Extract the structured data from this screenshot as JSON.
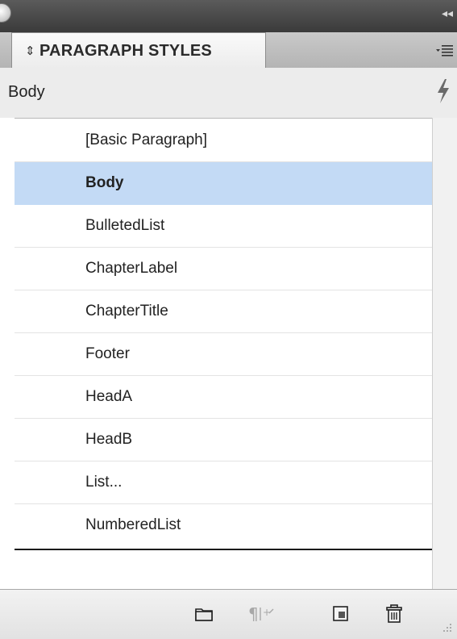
{
  "panel": {
    "tab_title": "PARAGRAPH STYLES",
    "current_style": "Body"
  },
  "styles": [
    {
      "label": "[Basic Paragraph]",
      "selected": false
    },
    {
      "label": "Body",
      "selected": true
    },
    {
      "label": "BulletedList",
      "selected": false
    },
    {
      "label": "ChapterLabel",
      "selected": false
    },
    {
      "label": "ChapterTitle",
      "selected": false
    },
    {
      "label": "Footer",
      "selected": false
    },
    {
      "label": "HeadA",
      "selected": false
    },
    {
      "label": "HeadB",
      "selected": false
    },
    {
      "label": "List...",
      "selected": false
    },
    {
      "label": "NumberedList",
      "selected": false
    }
  ],
  "toolbar_icons": [
    "folder-icon",
    "clear-overrides-icon",
    "new-style-icon",
    "trash-icon"
  ],
  "colors": {
    "selection": "#c3daf5",
    "titlebar": "#4a4a4a"
  }
}
